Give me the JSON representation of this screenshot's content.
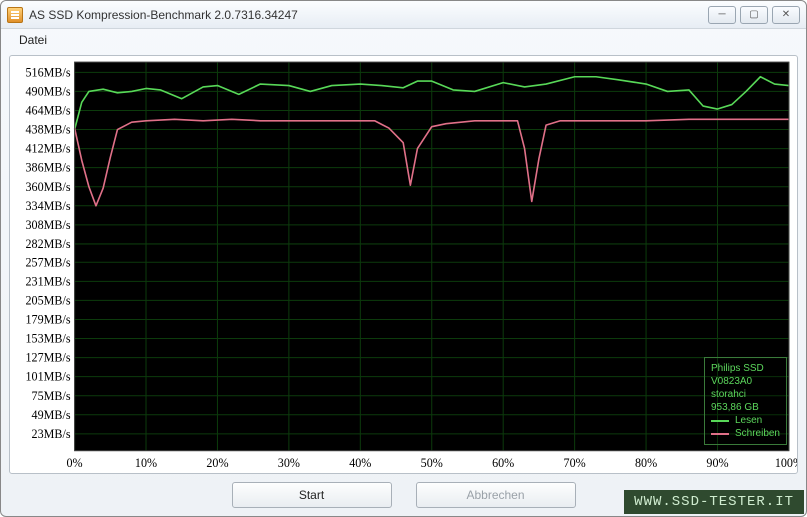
{
  "window": {
    "title": "AS SSD Kompression-Benchmark 2.0.7316.34247"
  },
  "menu": {
    "datei": "Datei"
  },
  "buttons": {
    "start": "Start",
    "abbrechen": "Abbrechen"
  },
  "legend": {
    "device_name": "Philips SSD",
    "firmware": "V0823A0",
    "driver": "storahci",
    "capacity": "953,86 GB",
    "read_label": "Lesen",
    "write_label": "Schreiben",
    "read_color": "#58d858",
    "write_color": "#e07088"
  },
  "watermark": "WWW.SSD-TESTER.IT",
  "chart_data": {
    "type": "line",
    "title": "",
    "xlabel": "",
    "ylabel": "",
    "xlim": [
      0,
      100
    ],
    "ylim": [
      0,
      530
    ],
    "x_ticks_pct": [
      0,
      10,
      20,
      30,
      40,
      50,
      60,
      70,
      80,
      90,
      100
    ],
    "y_ticks_mb": [
      23,
      49,
      75,
      101,
      127,
      153,
      179,
      205,
      231,
      257,
      282,
      308,
      334,
      360,
      386,
      412,
      438,
      464,
      490,
      516
    ],
    "y_tick_suffix": "MB/s",
    "x_tick_suffix": "%",
    "series": [
      {
        "name": "Lesen",
        "color": "#58d858",
        "x": [
          0,
          1,
          2,
          4,
          6,
          8,
          10,
          12,
          15,
          18,
          20,
          23,
          26,
          30,
          33,
          36,
          40,
          43,
          46,
          48,
          50,
          53,
          56,
          60,
          63,
          66,
          70,
          73,
          76,
          80,
          83,
          86,
          88,
          90,
          92,
          94,
          96,
          98,
          100
        ],
        "y": [
          438,
          475,
          490,
          493,
          488,
          490,
          494,
          492,
          480,
          496,
          498,
          486,
          500,
          498,
          490,
          498,
          500,
          498,
          495,
          504,
          504,
          492,
          490,
          502,
          496,
          500,
          510,
          510,
          506,
          500,
          490,
          492,
          470,
          466,
          472,
          490,
          510,
          500,
          498
        ]
      },
      {
        "name": "Schreiben",
        "color": "#e07088",
        "x": [
          0,
          1,
          2,
          3,
          4,
          5,
          6,
          8,
          10,
          14,
          18,
          22,
          26,
          30,
          34,
          38,
          42,
          44,
          46,
          47,
          48,
          50,
          52,
          56,
          60,
          62,
          63,
          64,
          65,
          66,
          68,
          72,
          76,
          80,
          86,
          90,
          94,
          98,
          100
        ],
        "y": [
          440,
          396,
          360,
          334,
          358,
          400,
          438,
          448,
          450,
          452,
          450,
          452,
          450,
          450,
          450,
          450,
          450,
          440,
          420,
          362,
          412,
          442,
          446,
          450,
          450,
          450,
          412,
          340,
          398,
          444,
          450,
          450,
          450,
          450,
          452,
          452,
          452,
          452,
          452
        ]
      }
    ]
  }
}
